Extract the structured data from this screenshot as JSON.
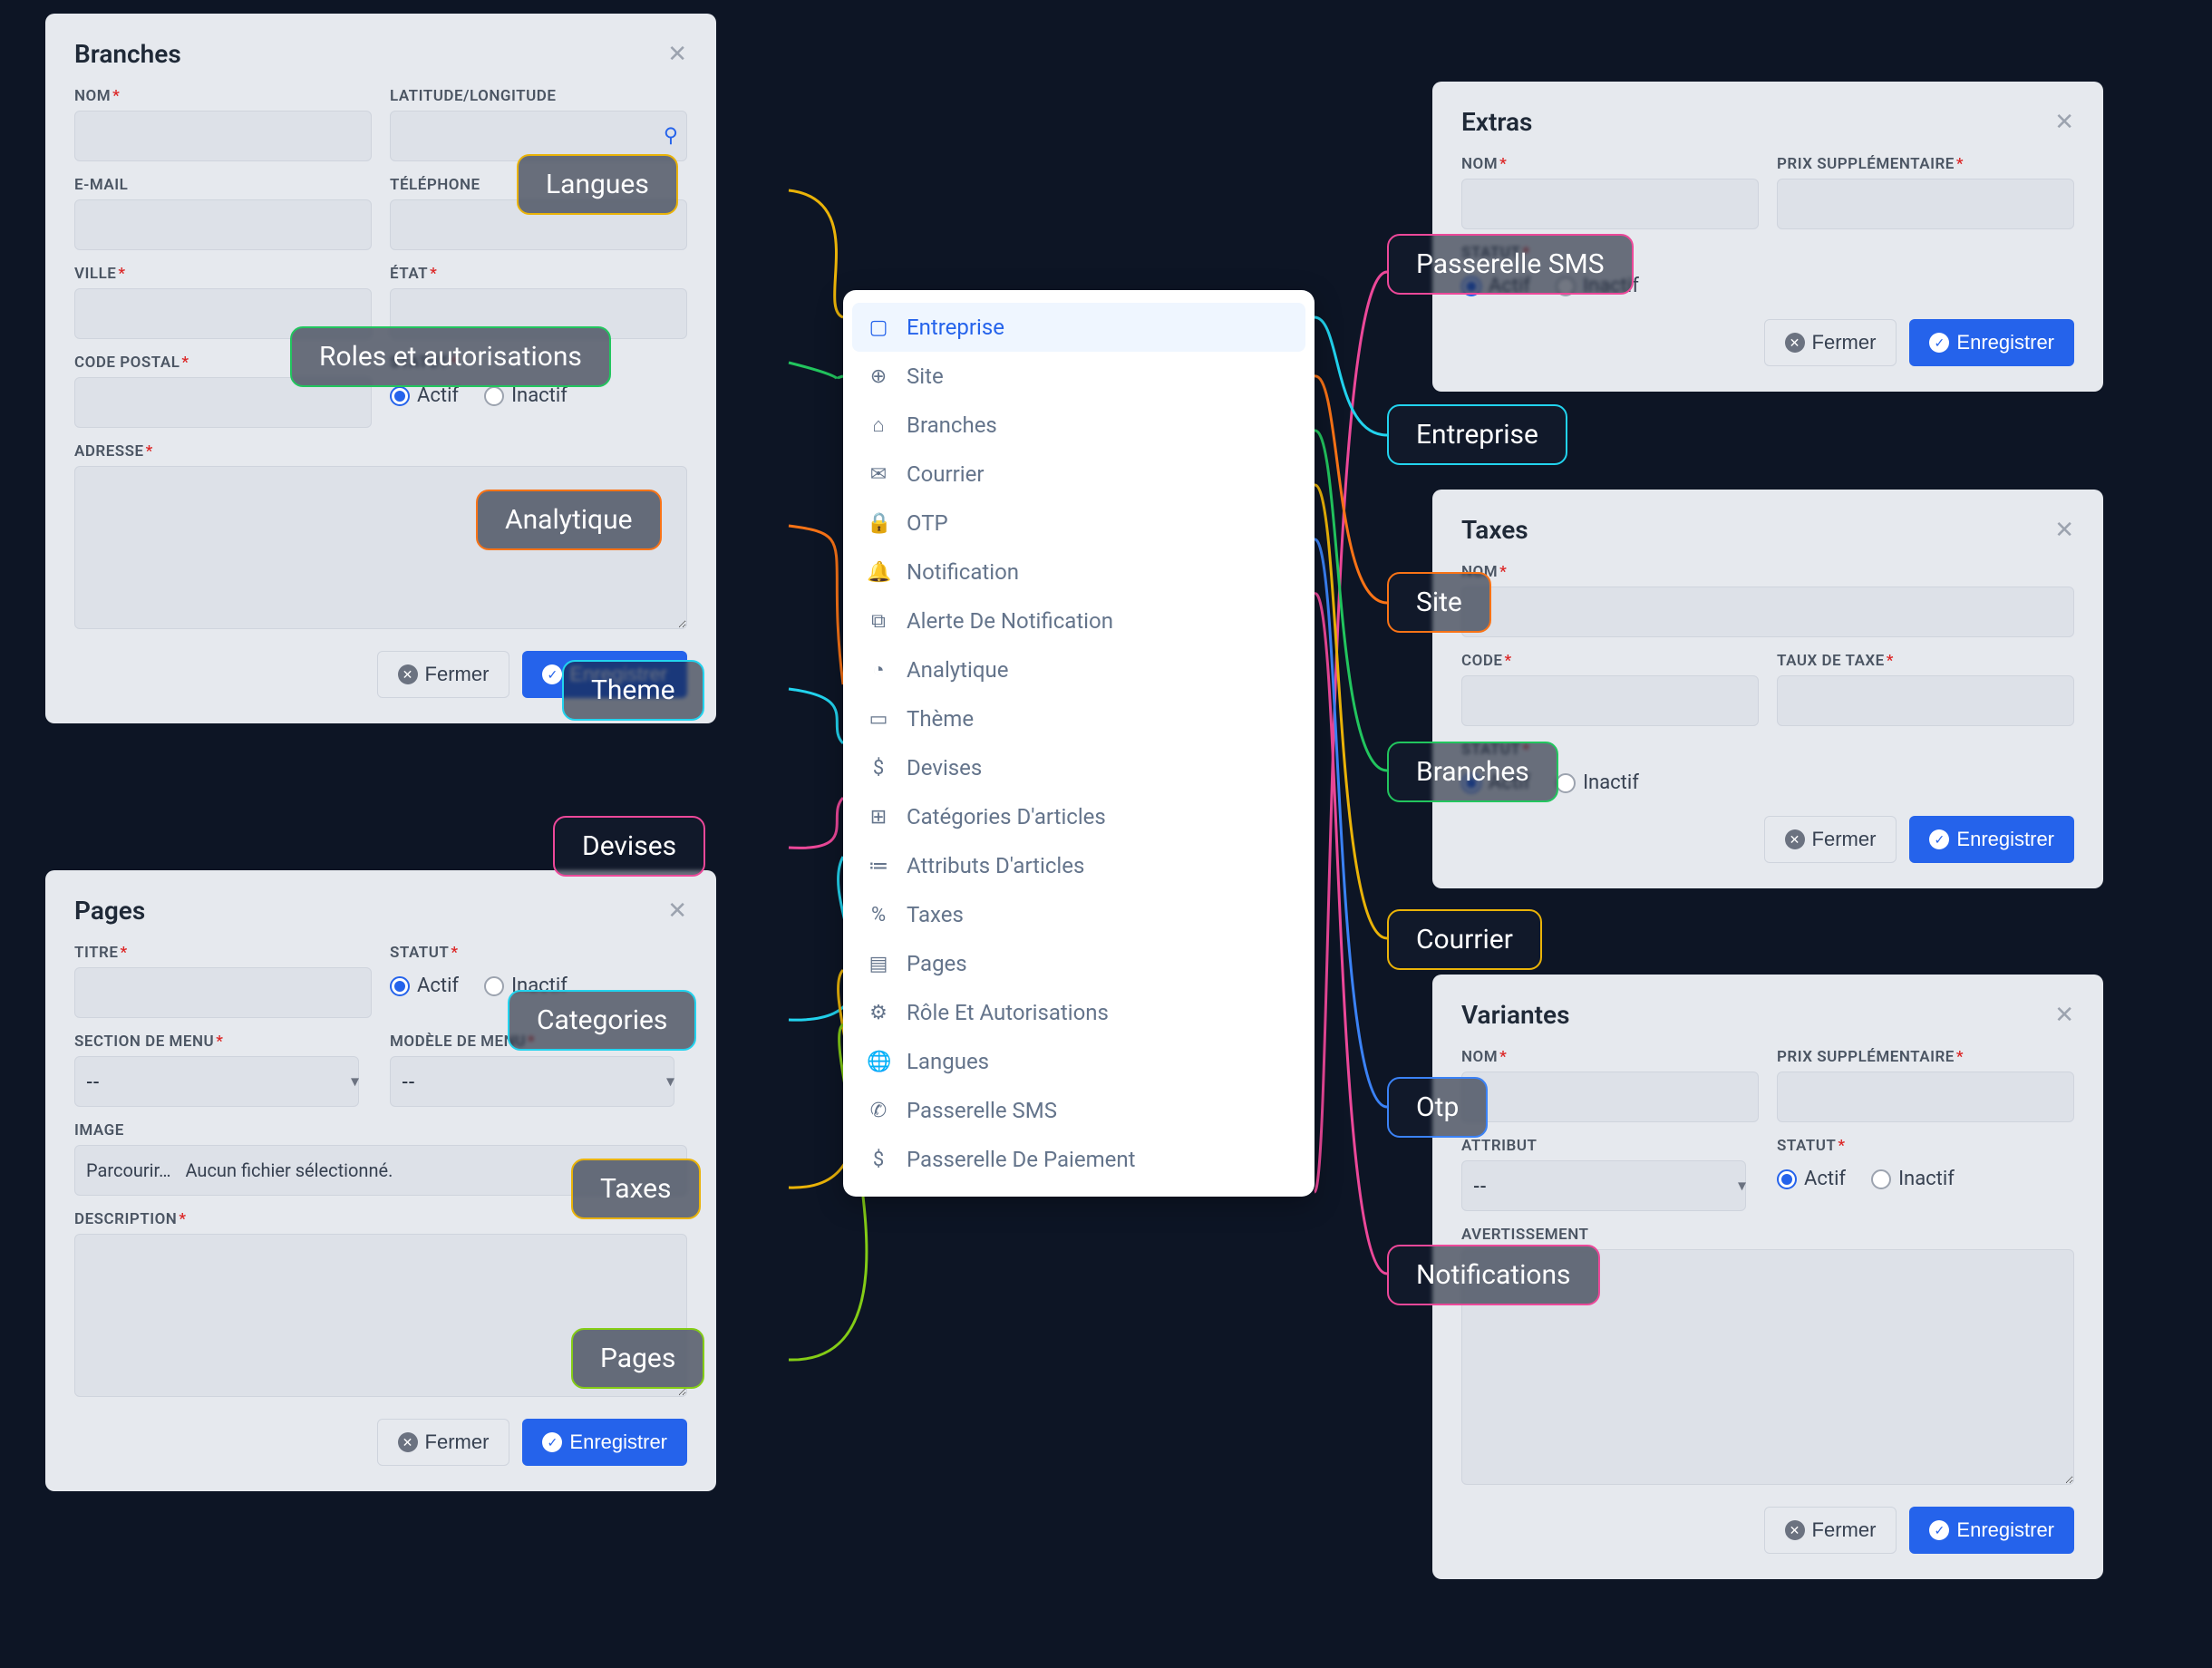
{
  "common": {
    "close_label": "Fermer",
    "save_label": "Enregistrer",
    "status_label": "STATUT",
    "active_label": "Actif",
    "inactive_label": "Inactif",
    "name_label": "NOM",
    "select_placeholder": "--",
    "file_browse": "Parcourir…",
    "file_none": "Aucun fichier sélectionné."
  },
  "branches": {
    "title": "Branches",
    "fields": {
      "nom": "NOM",
      "latlng": "LATITUDE/LONGITUDE",
      "email": "E-MAIL",
      "telephone": "TÉLÉPHONE",
      "ville": "VILLE",
      "etat": "ÉTAT",
      "code_postal": "CODE POSTAL",
      "adresse": "ADRESSE"
    }
  },
  "pages": {
    "title": "Pages",
    "fields": {
      "titre": "TITRE",
      "section_menu": "SECTION DE MENU",
      "modele_menu": "MODÈLE DE MENU",
      "image": "IMAGE",
      "description": "DESCRIPTION"
    }
  },
  "extras": {
    "title": "Extras",
    "fields": {
      "prix_supp": "PRIX SUPPLÉMENTAIRE"
    }
  },
  "taxes": {
    "title": "Taxes",
    "fields": {
      "code": "CODE",
      "taux": "TAUX DE TAXE"
    }
  },
  "variantes": {
    "title": "Variantes",
    "fields": {
      "prix_supp": "PRIX SUPPLÉMENTAIRE",
      "attribut": "ATTRIBUT",
      "avertissement": "AVERTISSEMENT"
    }
  },
  "menu": {
    "items": [
      {
        "icon": "▢",
        "label": "Entreprise",
        "active": true
      },
      {
        "icon": "⊕",
        "label": "Site"
      },
      {
        "icon": "⌂",
        "label": "Branches"
      },
      {
        "icon": "✉",
        "label": "Courrier"
      },
      {
        "icon": "🔒",
        "label": "OTP"
      },
      {
        "icon": "🔔",
        "label": "Notification"
      },
      {
        "icon": "⧉",
        "label": "Alerte De Notification"
      },
      {
        "icon": "◔",
        "label": "Analytique"
      },
      {
        "icon": "▭",
        "label": "Thème"
      },
      {
        "icon": "$",
        "label": "Devises"
      },
      {
        "icon": "⊞",
        "label": "Catégories D'articles"
      },
      {
        "icon": "≔",
        "label": "Attributs D'articles"
      },
      {
        "icon": "%",
        "label": "Taxes"
      },
      {
        "icon": "▤",
        "label": "Pages"
      },
      {
        "icon": "⚙",
        "label": "Rôle Et Autorisations"
      },
      {
        "icon": "🌐",
        "label": "Langues"
      },
      {
        "icon": "✆",
        "label": "Passerelle SMS"
      },
      {
        "icon": "$",
        "label": "Passerelle De Paiement"
      }
    ]
  },
  "tags": {
    "left": [
      {
        "label": "Langues",
        "color": "yellow"
      },
      {
        "label": "Roles et autorisations",
        "color": "green"
      },
      {
        "label": "Analytique",
        "color": "orange"
      },
      {
        "label": "Theme",
        "color": "cyan"
      },
      {
        "label": "Devises",
        "color": "pink"
      },
      {
        "label": "Categories",
        "color": "cyan"
      },
      {
        "label": "Taxes",
        "color": "yellow"
      },
      {
        "label": "Pages",
        "color": "lime"
      }
    ],
    "right": [
      {
        "label": "Passerelle SMS",
        "color": "pink"
      },
      {
        "label": "Entreprise",
        "color": "cyan"
      },
      {
        "label": "Site",
        "color": "orange"
      },
      {
        "label": "Branches",
        "color": "green"
      },
      {
        "label": "Courrier",
        "color": "yellow"
      },
      {
        "label": "Otp",
        "color": "blue"
      },
      {
        "label": "Notifications",
        "color": "pink"
      }
    ]
  }
}
